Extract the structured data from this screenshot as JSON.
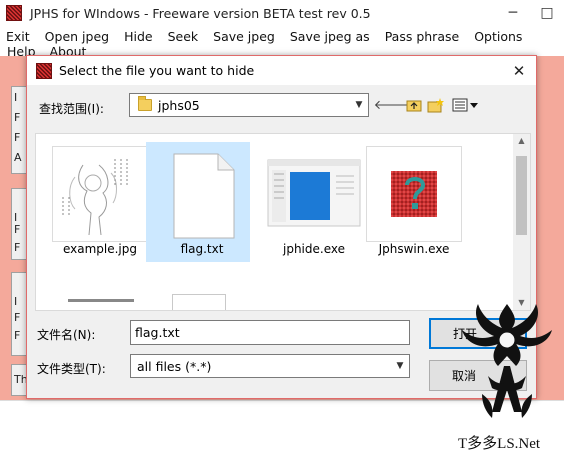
{
  "main_window": {
    "title": "JPHS for WIndows - Freeware version BETA test rev 0.5",
    "menu": [
      "Exit",
      "Open jpeg",
      "Hide",
      "Seek",
      "Save jpeg",
      "Save jpeg as",
      "Pass phrase",
      "Options"
    ],
    "menu_row2": [
      "Help",
      "About"
    ],
    "panel_glyphs": [
      "I",
      "F",
      "F",
      "A",
      "I",
      "F",
      "F",
      "I",
      "F",
      "F",
      "Th"
    ]
  },
  "dialog": {
    "title": "Select the file you want to hide",
    "look_in_label": "查找范围(I):",
    "look_in_value": "jphs05",
    "files": [
      {
        "name": "example.jpg",
        "thumb": "anime-sketch-image",
        "selected": false
      },
      {
        "name": "flag.txt",
        "thumb": "text-document",
        "selected": true
      },
      {
        "name": "jphide.exe",
        "thumb": "app-window",
        "selected": false
      },
      {
        "name": "Jphswin.exe",
        "thumb": "question-mark-image",
        "selected": false
      }
    ],
    "file_name_label": "文件名(N):",
    "file_name_value": "flag.txt",
    "file_type_label": "文件类型(T):",
    "file_type_value": "all files (*.*)",
    "open_button": "打开",
    "cancel_button": "取消"
  },
  "watermark_text": "T多多LS.Net",
  "colors": {
    "main_client_bg": "#f4a99b",
    "dialog_border": "#e06a6a",
    "selection": "#cce8ff",
    "default_button_border": "#0078d7"
  }
}
